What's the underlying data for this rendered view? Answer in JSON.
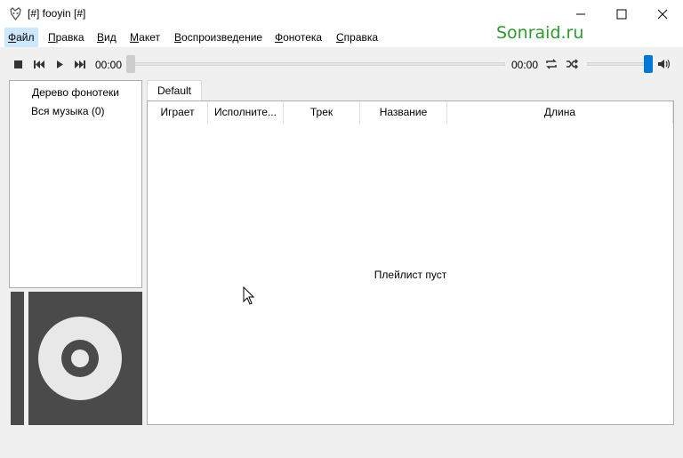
{
  "window": {
    "title": "[#] fooyin [#]"
  },
  "menu": {
    "items": [
      {
        "label": "Файл"
      },
      {
        "label": "Правка"
      },
      {
        "label": "Вид"
      },
      {
        "label": "Макет"
      },
      {
        "label": "Воспроизведение"
      },
      {
        "label": "Фонотека"
      },
      {
        "label": "Справка"
      }
    ]
  },
  "watermark": "Sonraid.ru",
  "player": {
    "elapsed": "00:00",
    "duration": "00:00",
    "seek_position": 0,
    "volume_level": 1.0
  },
  "library": {
    "header": "Дерево фонотеки",
    "item": "Вся музыка (0)"
  },
  "playlist": {
    "tab": "Default",
    "columns": [
      "Играет",
      "Исполните...",
      "Трек",
      "Название",
      "Длина"
    ],
    "empty_message": "Плейлист пуст"
  },
  "colors": {
    "accent": "#0078d7",
    "cover_bg": "#4a4a4a",
    "cover_disc": "#e8e8e8",
    "watermark": "#2e9a2e"
  }
}
